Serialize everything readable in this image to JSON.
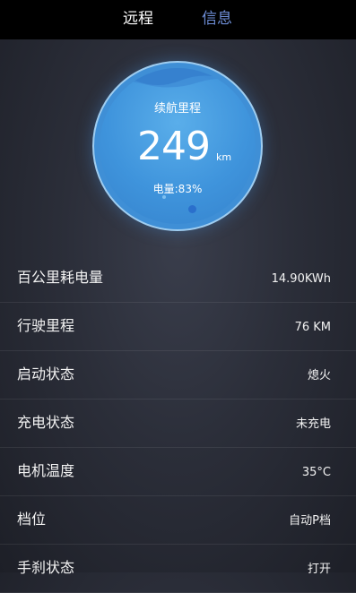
{
  "tabs": [
    {
      "label": "远程",
      "active": false
    },
    {
      "label": "信息",
      "active": true
    }
  ],
  "gauge": {
    "title": "续航里程",
    "value": "249",
    "unit": "km",
    "battery": "电量:83%",
    "battery_level": 0.83
  },
  "info_rows": [
    {
      "label": "百公里耗电量",
      "value": "14.90KWh"
    },
    {
      "label": "行驶里程",
      "value": "76 KM"
    },
    {
      "label": "启动状态",
      "value": "熄火"
    },
    {
      "label": "充电状态",
      "value": "未充电"
    },
    {
      "label": "电机温度",
      "value": "35°C"
    },
    {
      "label": "档位",
      "value": "自动P档"
    },
    {
      "label": "手刹状态",
      "value": "打开"
    }
  ],
  "colors": {
    "active_tab": "#6f8fd8",
    "gauge_blue": "#3f94dc"
  }
}
